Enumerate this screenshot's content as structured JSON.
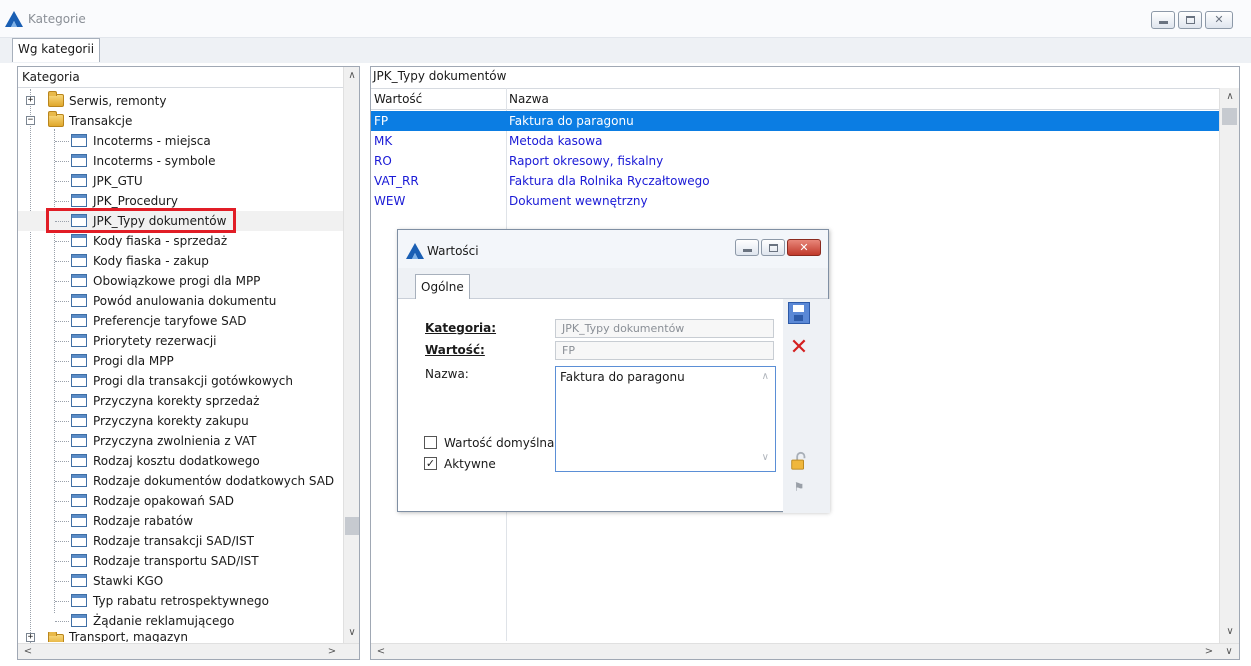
{
  "window": {
    "title": "Kategorie",
    "tab": "Wg kategorii"
  },
  "tree": {
    "header": "Kategoria",
    "groups": [
      {
        "label": "Serwis, remonty",
        "expander": "+"
      },
      {
        "label": "Transakcje",
        "expander": "−"
      }
    ],
    "items": [
      "Incoterms - miejsca",
      "Incoterms - symbole",
      "JPK_GTU",
      "JPK_Procedury",
      "JPK_Typy dokumentów",
      "Kody fiaska - sprzedaż",
      "Kody fiaska - zakup",
      "Obowiązkowe progi dla MPP",
      "Powód anulowania dokumentu",
      "Preferencje taryfowe SAD",
      "Priorytety rezerwacji",
      "Progi dla MPP",
      "Progi dla transakcji gotówkowych",
      "Przyczyna korekty sprzedaż",
      "Przyczyna korekty zakupu",
      "Przyczyna zwolnienia z VAT",
      "Rodzaj kosztu dodatkowego",
      "Rodzaje dokumentów dodatkowych SAD",
      "Rodzaje opakowań SAD",
      "Rodzaje rabatów",
      "Rodzaje transakcji SAD/IST",
      "Rodzaje transportu SAD/IST",
      "Stawki KGO",
      "Typ rabatu retrospektywnego",
      "Żądanie reklamującego"
    ],
    "trailing_group": "Transport, magazyn",
    "selected_item": "JPK_Typy dokumentów"
  },
  "grid": {
    "title": "JPK_Typy dokumentów",
    "columns": [
      "Wartość",
      "Nazwa"
    ],
    "rows": [
      {
        "value": "FP",
        "name": "Faktura do paragonu",
        "selected": true
      },
      {
        "value": "MK",
        "name": "Metoda kasowa"
      },
      {
        "value": "RO",
        "name": "Raport okresowy, fiskalny"
      },
      {
        "value": "VAT_RR",
        "name": "Faktura dla Rolnika Ryczałtowego"
      },
      {
        "value": "WEW",
        "name": "Dokument wewnętrzny"
      }
    ]
  },
  "dialog": {
    "title": "Wartości",
    "tab": "Ogólne",
    "kategoria_label": "Kategoria:",
    "kategoria_value": "JPK_Typy dokumentów",
    "wartosc_label": "Wartość:",
    "wartosc_value": "FP",
    "nazwa_label": "Nazwa:",
    "nazwa_value": "Faktura do paragonu",
    "default_label": "Wartość domyślna",
    "default_checked": false,
    "active_label": "Aktywne",
    "active_checked": true
  },
  "colors": {
    "selection": "#0b7de3",
    "link_text": "#1a1ad6",
    "highlight": "#e11d26"
  }
}
